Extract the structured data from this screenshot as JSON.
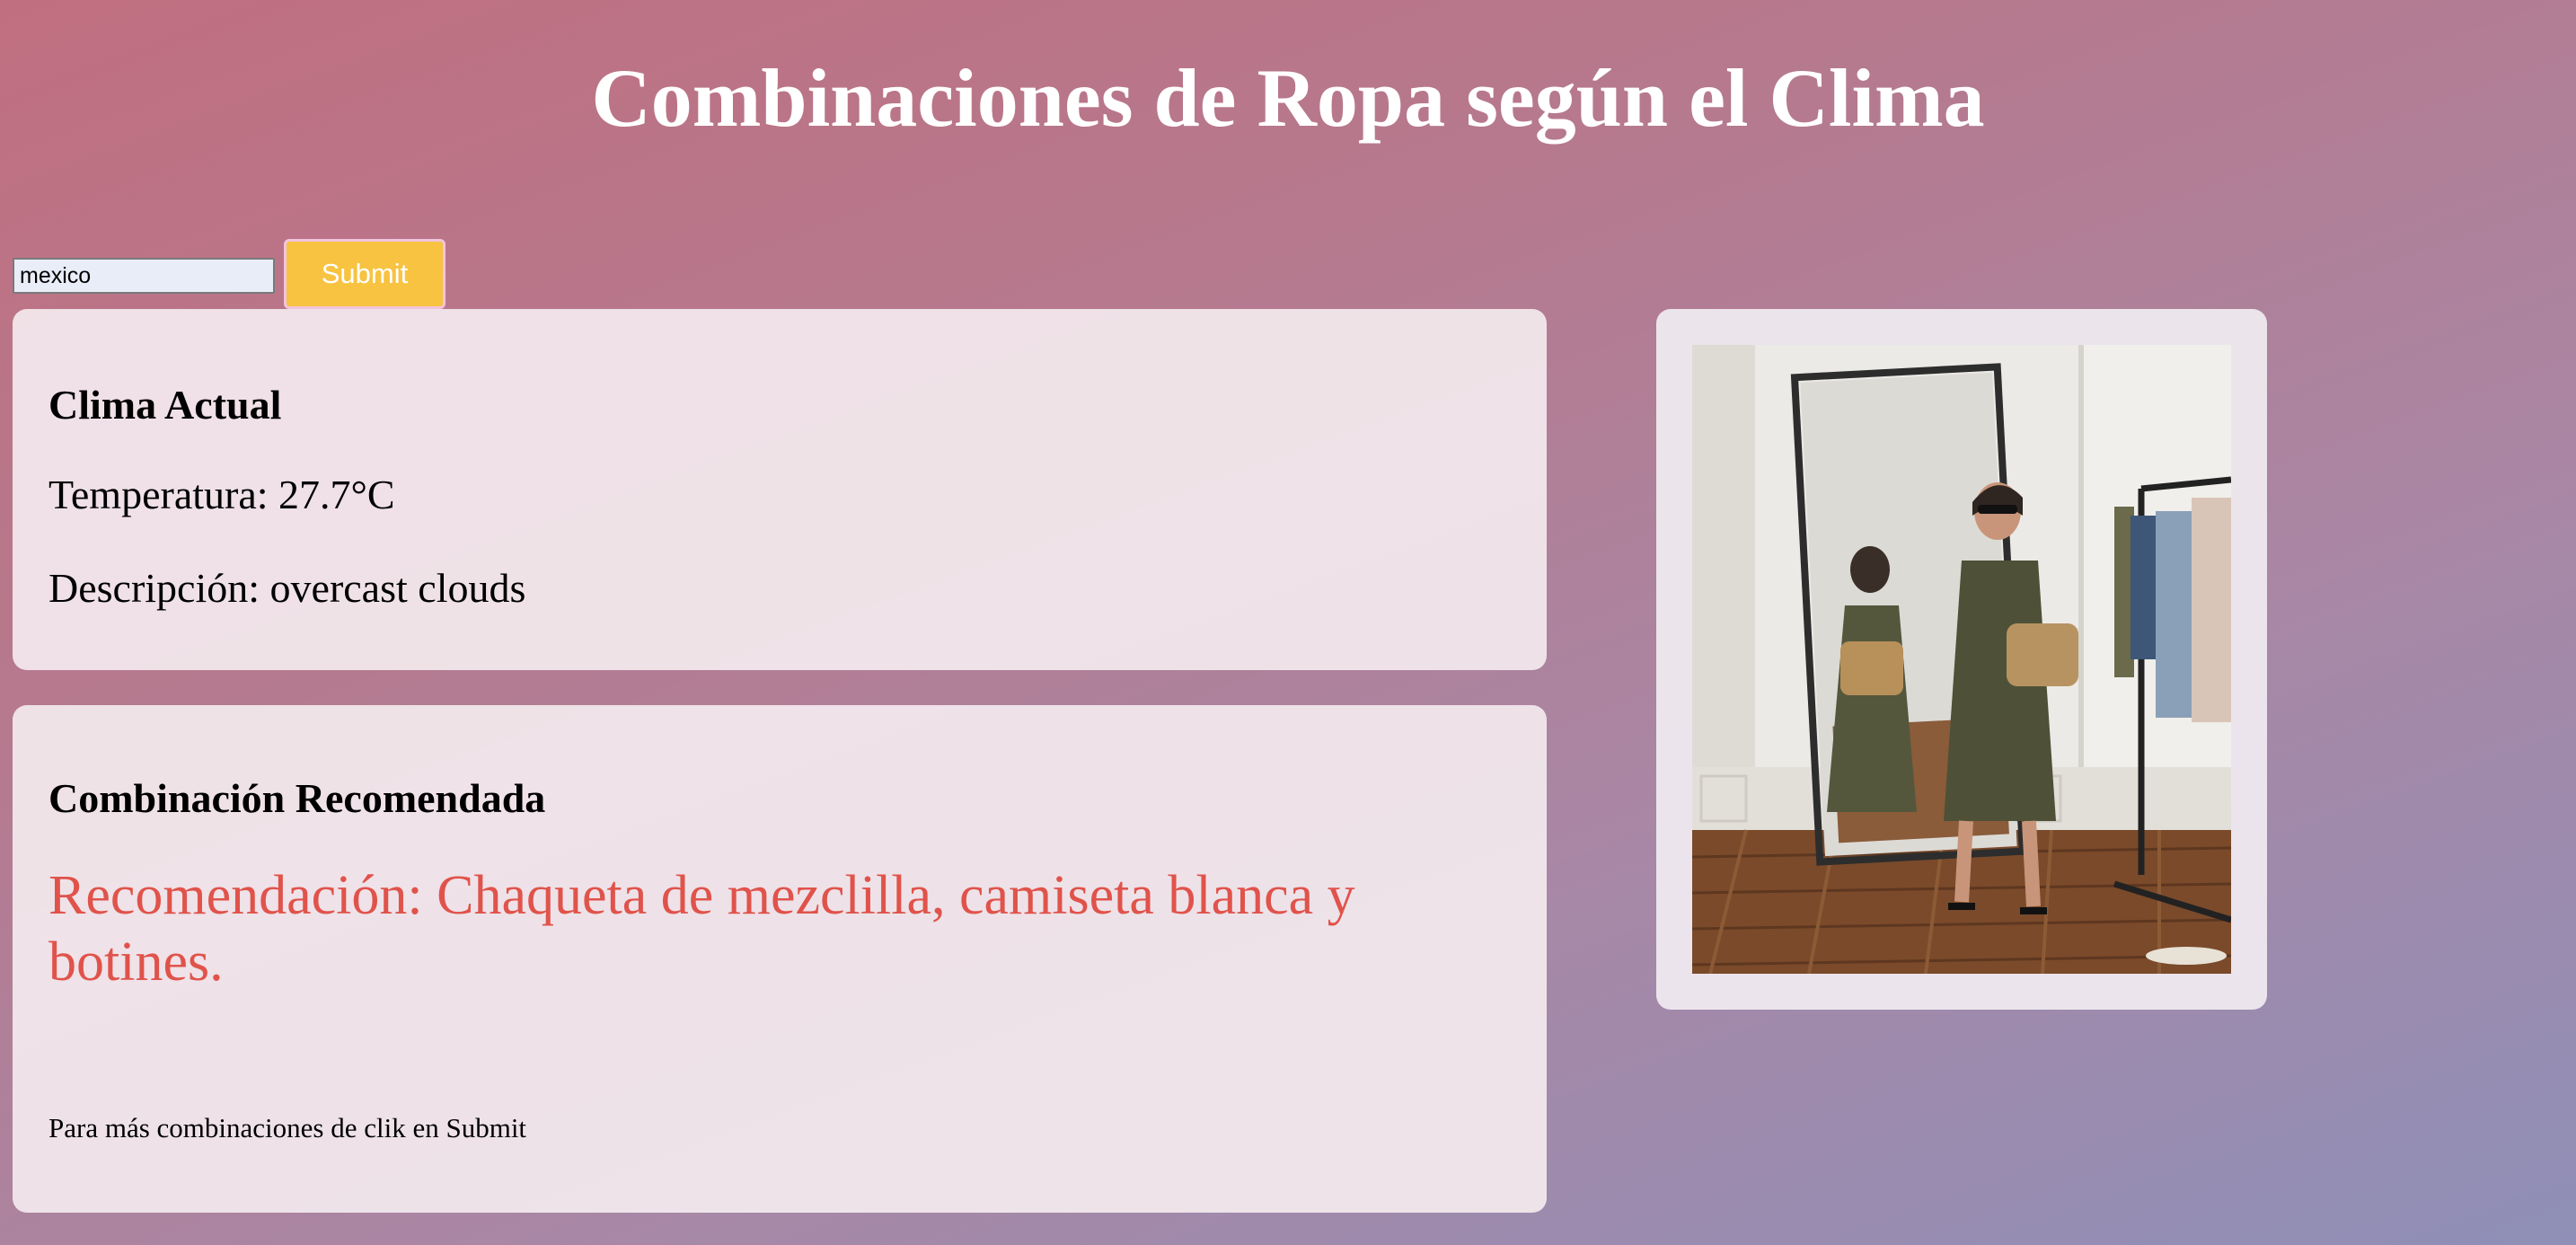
{
  "header": {
    "title": "Combinaciones de Ropa según el Clima"
  },
  "search": {
    "value": "mexico",
    "submit_label": "Submit"
  },
  "weather": {
    "heading": "Clima Actual",
    "temperature_line": "Temperatura: 27.7°C",
    "description_line": "Descripción: overcast clouds"
  },
  "outfit": {
    "heading": "Combinación Recomendada",
    "recommendation": "Recomendación: Chaqueta de mezclilla, camiseta blanca y botines.",
    "hint": "Para más combinaciones de clik en Submit"
  },
  "colors": {
    "accent_button": "#f7c341",
    "recommendation_text": "#e0534b",
    "card_background": "#f3e9ee"
  }
}
